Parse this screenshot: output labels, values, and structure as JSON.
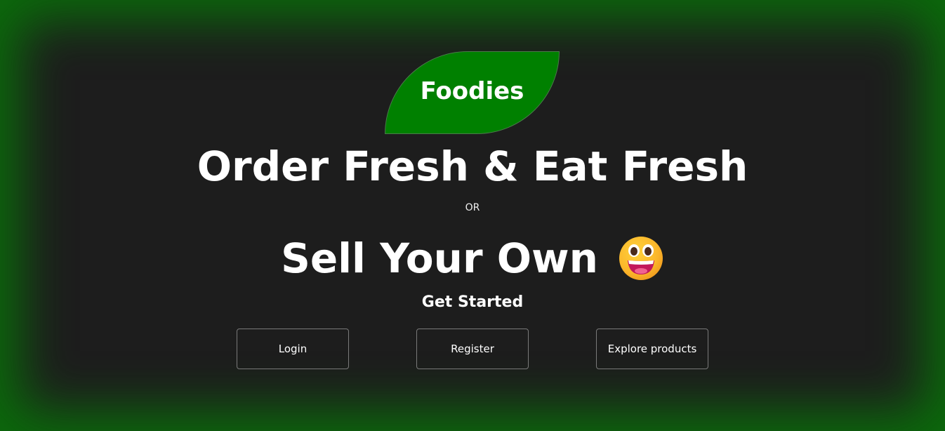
{
  "brand": {
    "name": "Foodies",
    "color": "#008000"
  },
  "hero": {
    "headline_1": "Order Fresh & Eat Fresh",
    "separator": "OR",
    "headline_2": "Sell Your Own",
    "emoji_icon": "grinning-face-emoji",
    "cta_heading": "Get Started"
  },
  "actions": {
    "login_label": "Login",
    "register_label": "Register",
    "explore_label": "Explore products"
  },
  "theme": {
    "background": "#1d1d1d",
    "vignette": "#0b6a0b"
  }
}
